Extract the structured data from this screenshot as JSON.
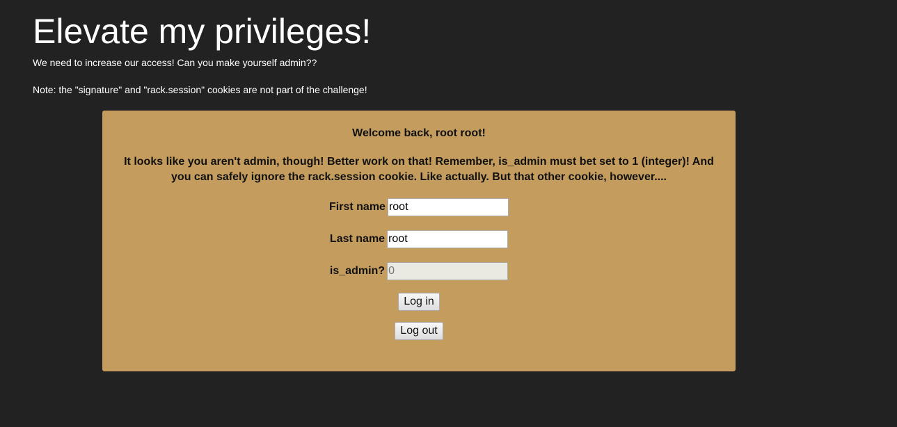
{
  "header": {
    "title": "Elevate my privileges!",
    "intro": "We need to increase our access! Can you make yourself admin??",
    "note": "Note: the \"signature\" and \"rack.session\" cookies are not part of the challenge!"
  },
  "panel": {
    "welcome": "Welcome back, root root!",
    "message": "It looks like you aren't admin, though! Better work on that! Remember, is_admin must bet set to 1 (integer)! And you can safely ignore the rack.session cookie. Like actually. But that other cookie, however....",
    "fields": [
      {
        "label": "First name",
        "value": "root"
      },
      {
        "label": "Last name",
        "value": "root"
      },
      {
        "label": "is_admin?",
        "value": "0"
      }
    ],
    "login_label": "Log in",
    "logout_label": "Log out"
  }
}
